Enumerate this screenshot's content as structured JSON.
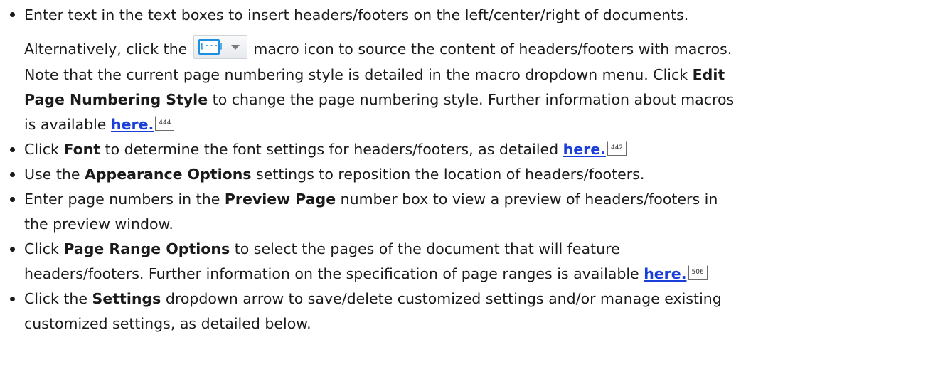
{
  "items": [
    {
      "line1": "Enter text in the text boxes to insert headers/footers on the left/center/right of documents.",
      "para_a_pre": "Alternatively, click the",
      "para_a_post": "macro icon to source the content of headers/footers with macros.",
      "para_b": "Note that the current page numbering style is detailed in the macro dropdown menu. Click",
      "para_b_bold": "Edit",
      "para_c_bold": "Page Numbering Style",
      "para_c": "to change the page numbering style. Further information about macros",
      "para_d": "is available",
      "link": "here.",
      "ref": "444"
    },
    {
      "pre": "Click",
      "bold": "Font",
      "post": "to determine the font settings for headers/footers, as detailed",
      "link": "here.",
      "ref": "442"
    },
    {
      "pre": "Use the",
      "bold": "Appearance Options",
      "post": "settings to reposition the location of headers/footers."
    },
    {
      "pre": "Enter page numbers in the",
      "bold": "Preview Page",
      "post": "number box to view a preview of headers/footers in",
      "line2": "the preview window."
    },
    {
      "pre": "Click",
      "bold": "Page Range Options",
      "post": "to select the pages of the document that will feature",
      "line2": "headers/footers. Further information on the specification of page ranges is available",
      "link": "here.",
      "ref": "506"
    },
    {
      "pre": "Click the",
      "bold": "Settings",
      "post": "dropdown arrow to save/delete customized settings and/or manage existing",
      "line2": "customized settings, as detailed below."
    }
  ],
  "macro_icon": {
    "glyph": "[···]",
    "icon": "macro-dropdown-icon"
  },
  "colors": {
    "link": "#1a3fd9",
    "macro_accent": "#1d8fe0"
  }
}
